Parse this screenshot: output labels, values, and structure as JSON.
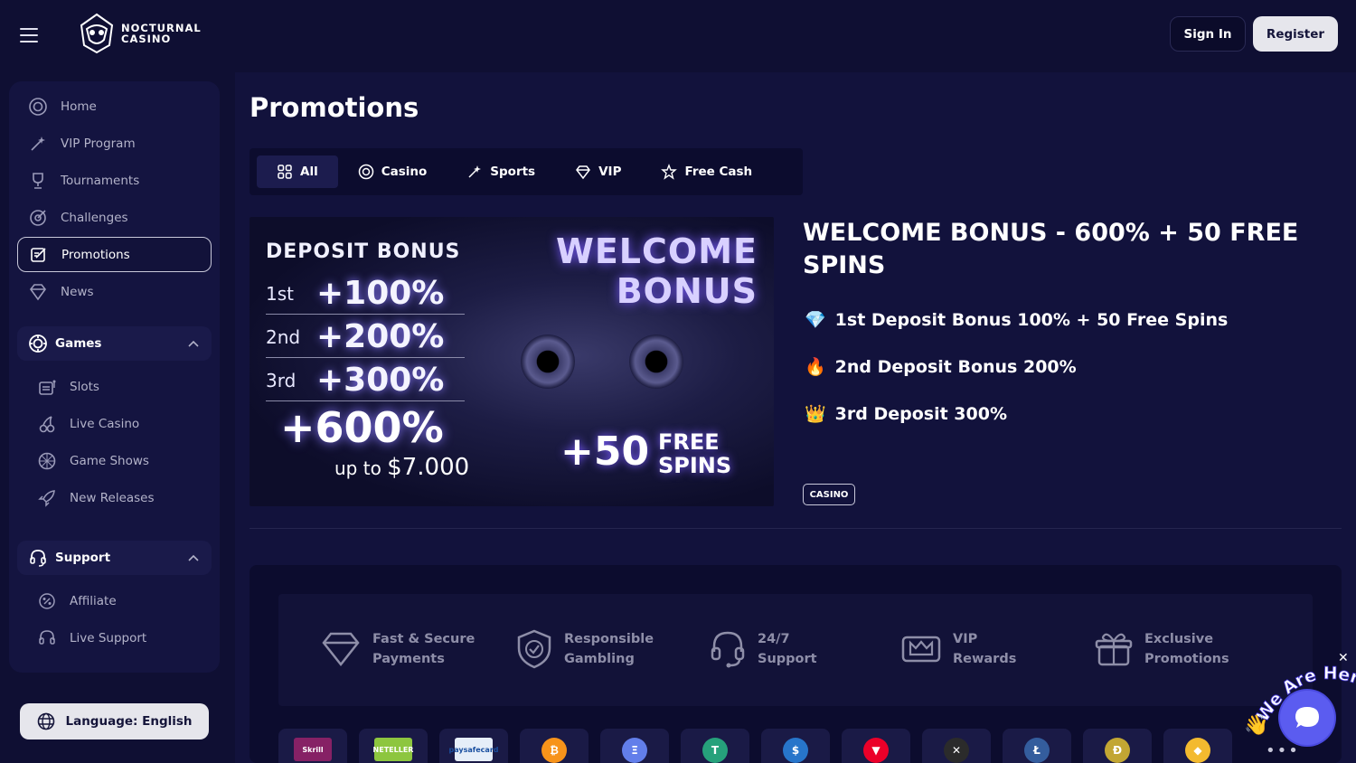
{
  "header": {
    "logo_line1": "NOCTURNAL",
    "logo_line2": "CASINO",
    "signin_label": "Sign In",
    "register_label": "Register"
  },
  "sidebar": {
    "items": [
      {
        "label": "Home",
        "icon": "home-icon"
      },
      {
        "label": "VIP Program",
        "icon": "magic-wand-icon"
      },
      {
        "label": "Tournaments",
        "icon": "trophy-icon"
      },
      {
        "label": "Challenges",
        "icon": "target-icon"
      },
      {
        "label": "Promotions",
        "icon": "edit-icon"
      },
      {
        "label": "News",
        "icon": "diamond-icon"
      }
    ],
    "games": {
      "title": "Games",
      "items": [
        {
          "label": "Slots",
          "icon": "slot-machine-icon"
        },
        {
          "label": "Live Casino",
          "icon": "cherries-icon"
        },
        {
          "label": "Game Shows",
          "icon": "wheel-icon"
        },
        {
          "label": "New Releases",
          "icon": "rocket-icon"
        }
      ]
    },
    "support": {
      "title": "Support",
      "items": [
        {
          "label": "Affiliate",
          "icon": "affiliate-icon"
        },
        {
          "label": "Live Support",
          "icon": "headset-icon"
        }
      ]
    },
    "language_label": "Language: English"
  },
  "main": {
    "title": "Promotions",
    "tabs": [
      {
        "label": "All",
        "icon": "grid-icon"
      },
      {
        "label": "Casino",
        "icon": "chip-icon"
      },
      {
        "label": "Sports",
        "icon": "magic-wand-icon"
      },
      {
        "label": "VIP",
        "icon": "diamond-icon"
      },
      {
        "label": "Free Cash",
        "icon": "star-icon"
      }
    ],
    "active_tab": "All",
    "banner": {
      "deposit_bonus": "DEPOSIT BONUS",
      "rows": [
        {
          "ord": "1st",
          "pct": "+100%"
        },
        {
          "ord": "2nd",
          "pct": "+200%"
        },
        {
          "ord": "3rd",
          "pct": "+300%"
        }
      ],
      "total": "+600%",
      "upto": "up to",
      "upto_amount": "$7.000",
      "welcome_1": "WELCOME",
      "welcome_2": "BONUS",
      "spins_num": "+50",
      "spins_1": "FREE",
      "spins_2": "SPINS"
    },
    "promo": {
      "title": "WELCOME BONUS - 600% + 50 FREE SPINS",
      "lines": [
        {
          "emoji": "💎",
          "text": "1st Deposit Bonus 100% + 50 Free Spins"
        },
        {
          "emoji": "🔥",
          "text": "2nd Deposit Bonus 200%"
        },
        {
          "emoji": "👑",
          "text": "3rd Deposit 300%"
        }
      ],
      "tag": "CASINO"
    },
    "features": [
      {
        "line1": "Fast & Secure",
        "line2": "Payments",
        "icon": "diamond-icon"
      },
      {
        "line1": "Responsible",
        "line2": "Gambling",
        "icon": "shield-check-icon"
      },
      {
        "line1": "24/7",
        "line2": "Support",
        "icon": "headset-icon"
      },
      {
        "line1": "VIP",
        "line2": "Rewards",
        "icon": "crown-icon"
      },
      {
        "line1": "Exclusive",
        "line2": "Promotions",
        "icon": "gift-icon"
      }
    ],
    "payments": [
      {
        "name": "Skrill",
        "color": "#862165"
      },
      {
        "name": "NETELLER",
        "color": "#8dc63f"
      },
      {
        "name": "paysafecard",
        "color": "#e6eef9"
      },
      {
        "name": "₿",
        "color": "#f7931a"
      },
      {
        "name": "Ξ",
        "color": "#627eea"
      },
      {
        "name": "T",
        "color": "#26a17b"
      },
      {
        "name": "$",
        "color": "#2775ca"
      },
      {
        "name": "▼",
        "color": "#eb0029"
      },
      {
        "name": "✕",
        "color": "#2b2b2b"
      },
      {
        "name": "Ł",
        "color": "#345d9d"
      },
      {
        "name": "Ð",
        "color": "#c2a633"
      },
      {
        "name": "◆",
        "color": "#f3ba2f"
      }
    ]
  },
  "chat": {
    "label": "We Are Here!",
    "close": "✕"
  }
}
